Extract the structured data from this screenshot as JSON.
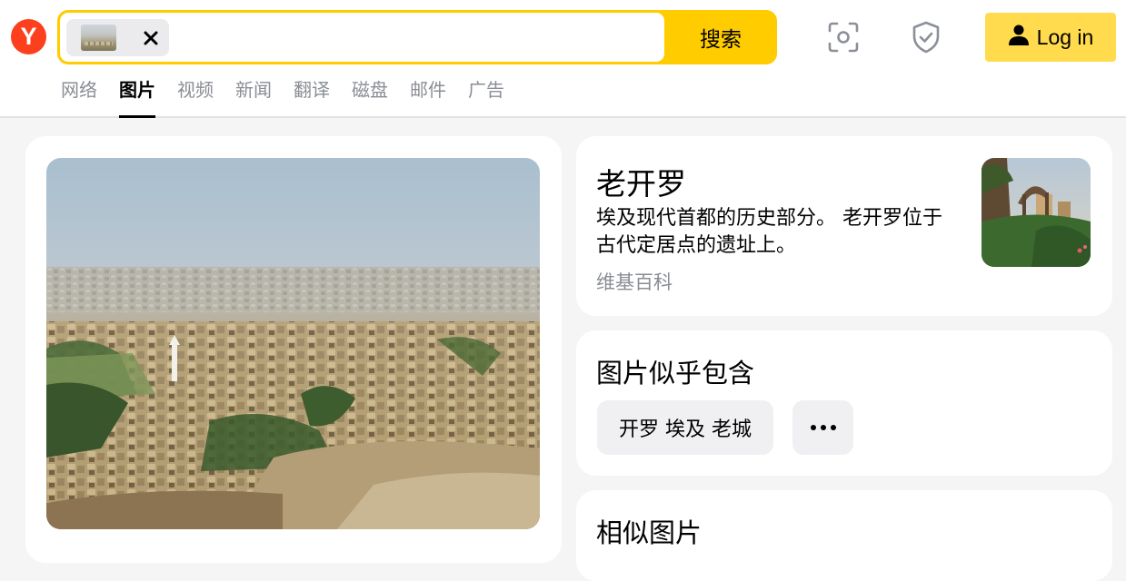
{
  "header": {
    "logo": {
      "letter": "Y",
      "color": "#fc3f1d"
    },
    "search": {
      "button_label": "搜索",
      "accent": "#ffcc00",
      "clear_icon": "close-icon"
    },
    "icons": [
      "camera-search-icon",
      "shield-check-icon"
    ],
    "login": {
      "label": "Log in",
      "icon": "user-icon",
      "color": "#ffdb4d"
    }
  },
  "tabs": [
    {
      "label": "网络",
      "active": false
    },
    {
      "label": "图片",
      "active": true
    },
    {
      "label": "视频",
      "active": false
    },
    {
      "label": "新闻",
      "active": false
    },
    {
      "label": "翻译",
      "active": false
    },
    {
      "label": "磁盘",
      "active": false
    },
    {
      "label": "邮件",
      "active": false
    },
    {
      "label": "广告",
      "active": false
    }
  ],
  "info": {
    "title": "老开罗",
    "description": "埃及现代首都的历史部分。 老开罗位于古代定居点的遗址上。",
    "source": "维基百科"
  },
  "contains": {
    "title": "图片似乎包含",
    "tag": "开罗 埃及 老城",
    "more_icon": "more-dots-icon"
  },
  "similar": {
    "title": "相似图片"
  }
}
